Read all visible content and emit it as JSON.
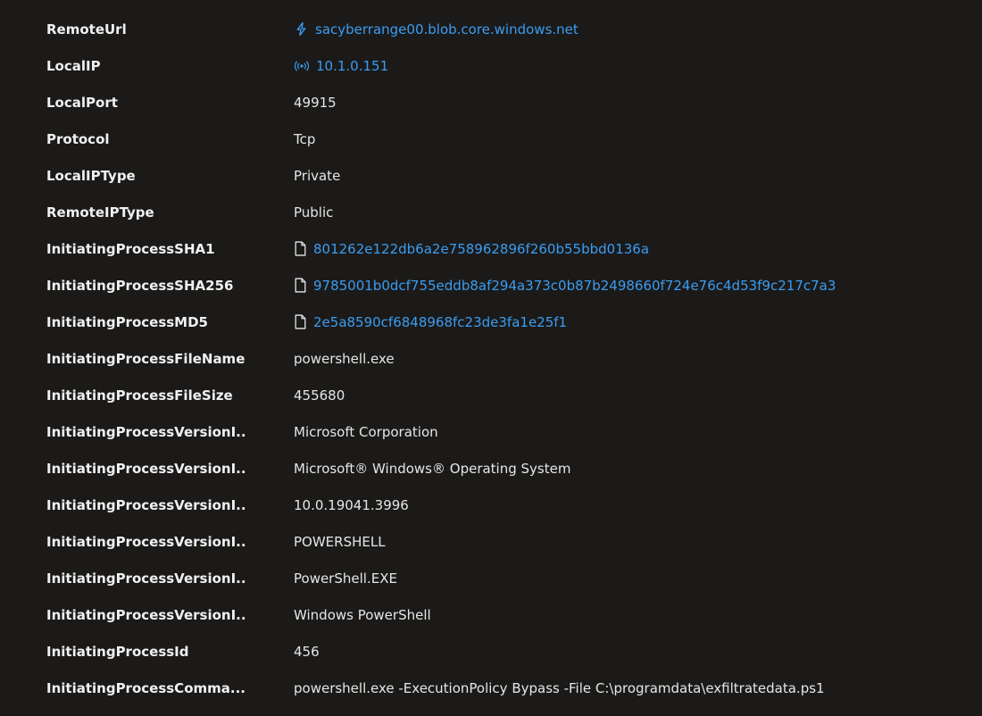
{
  "colors": {
    "background": "#1b1a19",
    "key_text": "#f0f0f0",
    "value_text": "#e6e6e6",
    "link": "#3b9cf0"
  },
  "rows": [
    {
      "key": "RemoteUrl",
      "value": "sacyberrange00.blob.core.windows.net",
      "icon": "url-icon",
      "link": true
    },
    {
      "key": "LocalIP",
      "value": "10.1.0.151",
      "icon": "ip-address-icon",
      "link": true
    },
    {
      "key": "LocalPort",
      "value": "49915"
    },
    {
      "key": "Protocol",
      "value": "Tcp"
    },
    {
      "key": "LocalIPType",
      "value": "Private"
    },
    {
      "key": "RemoteIPType",
      "value": "Public"
    },
    {
      "key": "InitiatingProcessSHA1",
      "value": "801262e122db6a2e758962896f260b55bbd0136a",
      "icon": "file-icon",
      "link": true
    },
    {
      "key": "InitiatingProcessSHA256",
      "value": "9785001b0dcf755eddb8af294a373c0b87b2498660f724e76c4d53f9c217c7a3",
      "icon": "file-icon",
      "link": true
    },
    {
      "key": "InitiatingProcessMD5",
      "value": "2e5a8590cf6848968fc23de3fa1e25f1",
      "icon": "file-icon",
      "link": true
    },
    {
      "key": "InitiatingProcessFileName",
      "value": "powershell.exe"
    },
    {
      "key": "InitiatingProcessFileSize",
      "value": "455680"
    },
    {
      "key": "InitiatingProcessVersionI...",
      "value": "Microsoft Corporation"
    },
    {
      "key": "InitiatingProcessVersionI...",
      "value": "Microsoft® Windows® Operating System"
    },
    {
      "key": "InitiatingProcessVersionI...",
      "value": "10.0.19041.3996"
    },
    {
      "key": "InitiatingProcessVersionI...",
      "value": "POWERSHELL"
    },
    {
      "key": "InitiatingProcessVersionI...",
      "value": "PowerShell.EXE"
    },
    {
      "key": "InitiatingProcessVersionI...",
      "value": "Windows PowerShell"
    },
    {
      "key": "InitiatingProcessId",
      "value": "456"
    },
    {
      "key": "InitiatingProcessComma...",
      "value": "powershell.exe -ExecutionPolicy Bypass -File C:\\programdata\\exfiltratedata.ps1"
    }
  ]
}
